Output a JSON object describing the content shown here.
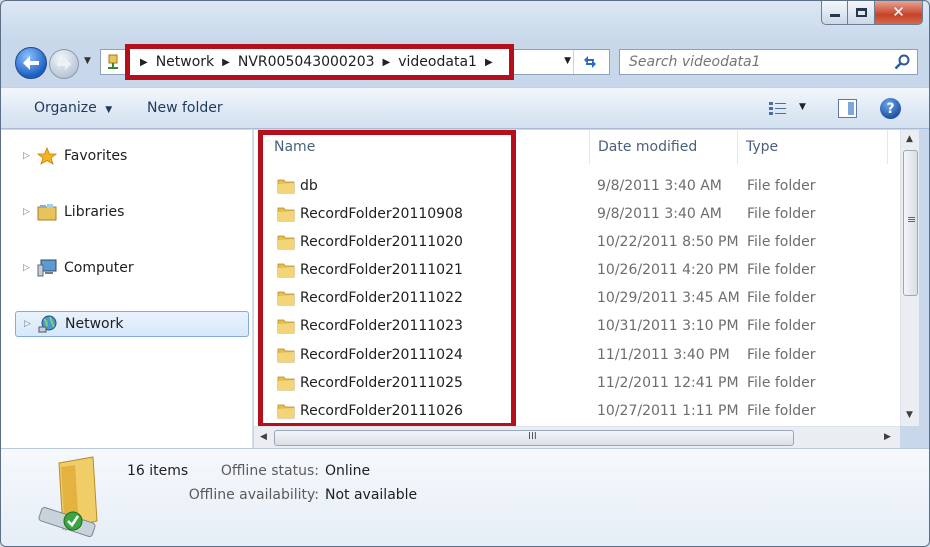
{
  "address": {
    "crumbs": [
      "Network",
      "NVR005043000203",
      "videodata1"
    ]
  },
  "search": {
    "placeholder": "Search videodata1"
  },
  "toolbar": {
    "organize": "Organize",
    "new_folder": "New folder",
    "help": "?"
  },
  "nav": {
    "items": [
      {
        "label": "Favorites"
      },
      {
        "label": "Libraries"
      },
      {
        "label": "Computer"
      },
      {
        "label": "Network"
      }
    ]
  },
  "columns": {
    "name": "Name",
    "date": "Date modified",
    "type": "Type"
  },
  "files": [
    {
      "name": "db",
      "date": "9/8/2011 3:40 AM",
      "type": "File folder"
    },
    {
      "name": "RecordFolder20110908",
      "date": "9/8/2011 3:40 AM",
      "type": "File folder"
    },
    {
      "name": "RecordFolder20111020",
      "date": "10/22/2011 8:50 PM",
      "type": "File folder"
    },
    {
      "name": "RecordFolder20111021",
      "date": "10/26/2011 4:20 PM",
      "type": "File folder"
    },
    {
      "name": "RecordFolder20111022",
      "date": "10/29/2011 3:45 AM",
      "type": "File folder"
    },
    {
      "name": "RecordFolder20111023",
      "date": "10/31/2011 3:10 PM",
      "type": "File folder"
    },
    {
      "name": "RecordFolder20111024",
      "date": "11/1/2011 3:40 PM",
      "type": "File folder"
    },
    {
      "name": "RecordFolder20111025",
      "date": "11/2/2011 12:41 PM",
      "type": "File folder"
    },
    {
      "name": "RecordFolder20111026",
      "date": "10/27/2011 1:11 PM",
      "type": "File folder"
    }
  ],
  "details": {
    "count": "16 items",
    "offline_status_label": "Offline status:",
    "offline_status_value": "Online",
    "offline_avail_label": "Offline availability:",
    "offline_avail_value": "Not available"
  },
  "colors": {
    "highlight": "#b4101b",
    "folder": "#e9bd4c"
  }
}
